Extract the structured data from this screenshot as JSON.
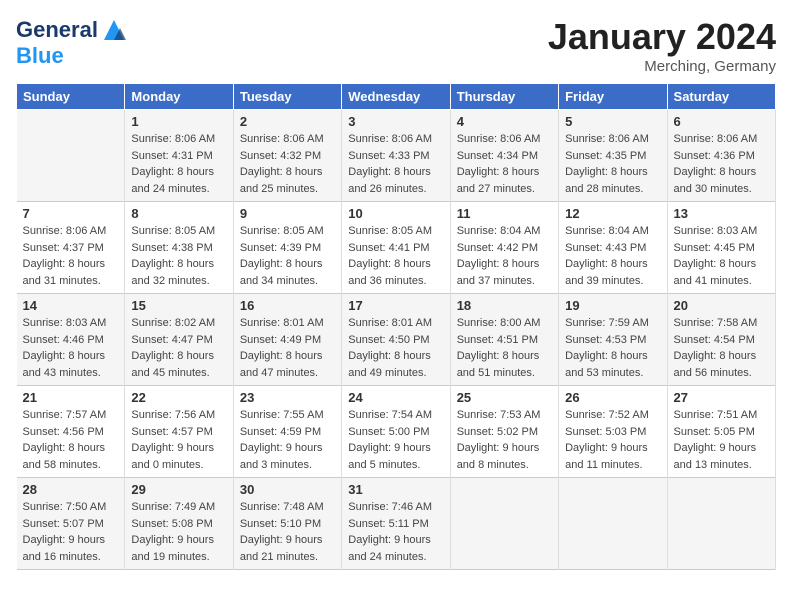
{
  "header": {
    "logo_line1": "General",
    "logo_line2": "Blue",
    "month": "January 2024",
    "location": "Merching, Germany"
  },
  "days_of_week": [
    "Sunday",
    "Monday",
    "Tuesday",
    "Wednesday",
    "Thursday",
    "Friday",
    "Saturday"
  ],
  "weeks": [
    [
      {
        "day": "",
        "info": ""
      },
      {
        "day": "1",
        "info": "Sunrise: 8:06 AM\nSunset: 4:31 PM\nDaylight: 8 hours\nand 24 minutes."
      },
      {
        "day": "2",
        "info": "Sunrise: 8:06 AM\nSunset: 4:32 PM\nDaylight: 8 hours\nand 25 minutes."
      },
      {
        "day": "3",
        "info": "Sunrise: 8:06 AM\nSunset: 4:33 PM\nDaylight: 8 hours\nand 26 minutes."
      },
      {
        "day": "4",
        "info": "Sunrise: 8:06 AM\nSunset: 4:34 PM\nDaylight: 8 hours\nand 27 minutes."
      },
      {
        "day": "5",
        "info": "Sunrise: 8:06 AM\nSunset: 4:35 PM\nDaylight: 8 hours\nand 28 minutes."
      },
      {
        "day": "6",
        "info": "Sunrise: 8:06 AM\nSunset: 4:36 PM\nDaylight: 8 hours\nand 30 minutes."
      }
    ],
    [
      {
        "day": "7",
        "info": "Sunrise: 8:06 AM\nSunset: 4:37 PM\nDaylight: 8 hours\nand 31 minutes."
      },
      {
        "day": "8",
        "info": "Sunrise: 8:05 AM\nSunset: 4:38 PM\nDaylight: 8 hours\nand 32 minutes."
      },
      {
        "day": "9",
        "info": "Sunrise: 8:05 AM\nSunset: 4:39 PM\nDaylight: 8 hours\nand 34 minutes."
      },
      {
        "day": "10",
        "info": "Sunrise: 8:05 AM\nSunset: 4:41 PM\nDaylight: 8 hours\nand 36 minutes."
      },
      {
        "day": "11",
        "info": "Sunrise: 8:04 AM\nSunset: 4:42 PM\nDaylight: 8 hours\nand 37 minutes."
      },
      {
        "day": "12",
        "info": "Sunrise: 8:04 AM\nSunset: 4:43 PM\nDaylight: 8 hours\nand 39 minutes."
      },
      {
        "day": "13",
        "info": "Sunrise: 8:03 AM\nSunset: 4:45 PM\nDaylight: 8 hours\nand 41 minutes."
      }
    ],
    [
      {
        "day": "14",
        "info": "Sunrise: 8:03 AM\nSunset: 4:46 PM\nDaylight: 8 hours\nand 43 minutes."
      },
      {
        "day": "15",
        "info": "Sunrise: 8:02 AM\nSunset: 4:47 PM\nDaylight: 8 hours\nand 45 minutes."
      },
      {
        "day": "16",
        "info": "Sunrise: 8:01 AM\nSunset: 4:49 PM\nDaylight: 8 hours\nand 47 minutes."
      },
      {
        "day": "17",
        "info": "Sunrise: 8:01 AM\nSunset: 4:50 PM\nDaylight: 8 hours\nand 49 minutes."
      },
      {
        "day": "18",
        "info": "Sunrise: 8:00 AM\nSunset: 4:51 PM\nDaylight: 8 hours\nand 51 minutes."
      },
      {
        "day": "19",
        "info": "Sunrise: 7:59 AM\nSunset: 4:53 PM\nDaylight: 8 hours\nand 53 minutes."
      },
      {
        "day": "20",
        "info": "Sunrise: 7:58 AM\nSunset: 4:54 PM\nDaylight: 8 hours\nand 56 minutes."
      }
    ],
    [
      {
        "day": "21",
        "info": "Sunrise: 7:57 AM\nSunset: 4:56 PM\nDaylight: 8 hours\nand 58 minutes."
      },
      {
        "day": "22",
        "info": "Sunrise: 7:56 AM\nSunset: 4:57 PM\nDaylight: 9 hours\nand 0 minutes."
      },
      {
        "day": "23",
        "info": "Sunrise: 7:55 AM\nSunset: 4:59 PM\nDaylight: 9 hours\nand 3 minutes."
      },
      {
        "day": "24",
        "info": "Sunrise: 7:54 AM\nSunset: 5:00 PM\nDaylight: 9 hours\nand 5 minutes."
      },
      {
        "day": "25",
        "info": "Sunrise: 7:53 AM\nSunset: 5:02 PM\nDaylight: 9 hours\nand 8 minutes."
      },
      {
        "day": "26",
        "info": "Sunrise: 7:52 AM\nSunset: 5:03 PM\nDaylight: 9 hours\nand 11 minutes."
      },
      {
        "day": "27",
        "info": "Sunrise: 7:51 AM\nSunset: 5:05 PM\nDaylight: 9 hours\nand 13 minutes."
      }
    ],
    [
      {
        "day": "28",
        "info": "Sunrise: 7:50 AM\nSunset: 5:07 PM\nDaylight: 9 hours\nand 16 minutes."
      },
      {
        "day": "29",
        "info": "Sunrise: 7:49 AM\nSunset: 5:08 PM\nDaylight: 9 hours\nand 19 minutes."
      },
      {
        "day": "30",
        "info": "Sunrise: 7:48 AM\nSunset: 5:10 PM\nDaylight: 9 hours\nand 21 minutes."
      },
      {
        "day": "31",
        "info": "Sunrise: 7:46 AM\nSunset: 5:11 PM\nDaylight: 9 hours\nand 24 minutes."
      },
      {
        "day": "",
        "info": ""
      },
      {
        "day": "",
        "info": ""
      },
      {
        "day": "",
        "info": ""
      }
    ]
  ]
}
